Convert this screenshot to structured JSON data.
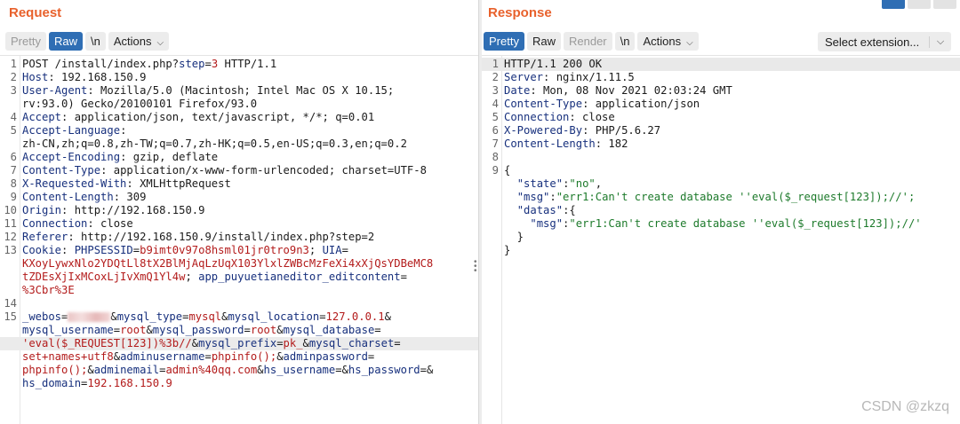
{
  "request": {
    "title": "Request",
    "tabs": [
      {
        "label": "Pretty",
        "state": "inactive"
      },
      {
        "label": "Raw",
        "state": "active"
      },
      {
        "label": "\\n",
        "state": "normal"
      },
      {
        "label": "Actions",
        "state": "normal"
      }
    ]
  },
  "response": {
    "title": "Response",
    "tabs": [
      {
        "label": "Pretty",
        "state": "active"
      },
      {
        "label": "Raw",
        "state": "normal"
      },
      {
        "label": "Render",
        "state": "inactive"
      },
      {
        "label": "\\n",
        "state": "normal"
      },
      {
        "label": "Actions",
        "state": "normal"
      }
    ],
    "extension_select": "Select extension..."
  },
  "watermark": "CSDN @zkzq",
  "colors": {
    "accent": "#e8612c",
    "active_tab": "#2f6eb4",
    "key": "#17307d",
    "value": "#b31b1b",
    "json_string": "#1d7a2b"
  }
}
